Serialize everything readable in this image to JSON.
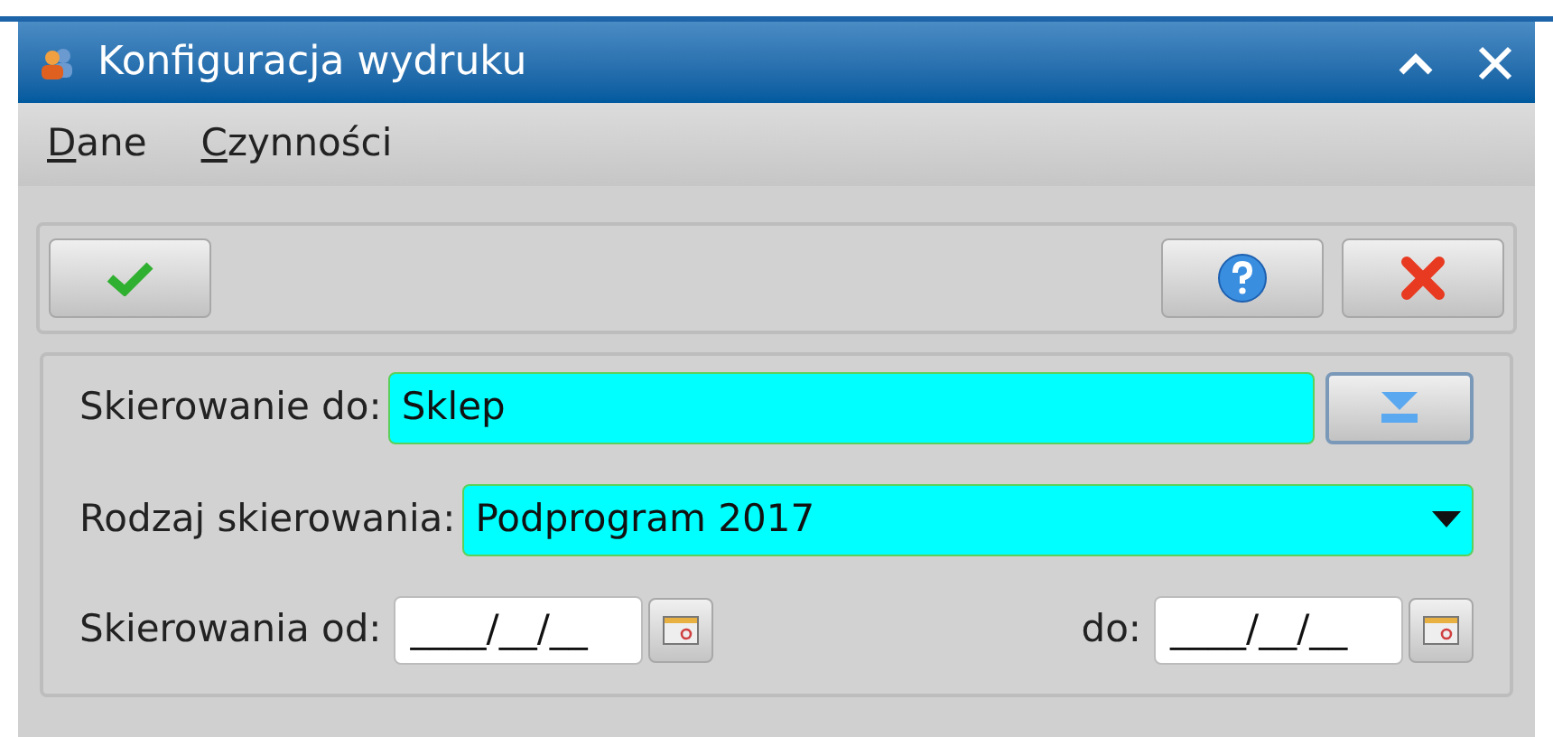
{
  "window": {
    "title": "Konfiguracja wydruku"
  },
  "menu": [
    {
      "label": "Dane"
    },
    {
      "label": "Czynności"
    }
  ],
  "form": {
    "recipient": {
      "label": "Skierowanie do:",
      "value": "Sklep"
    },
    "type": {
      "label": "Rodzaj skierowania:",
      "value": "Podprogram 2017"
    },
    "date_from": {
      "label": "Skierowania od:",
      "value": "____/__/__"
    },
    "date_to": {
      "label": "do:",
      "value": "____/__/__"
    }
  }
}
